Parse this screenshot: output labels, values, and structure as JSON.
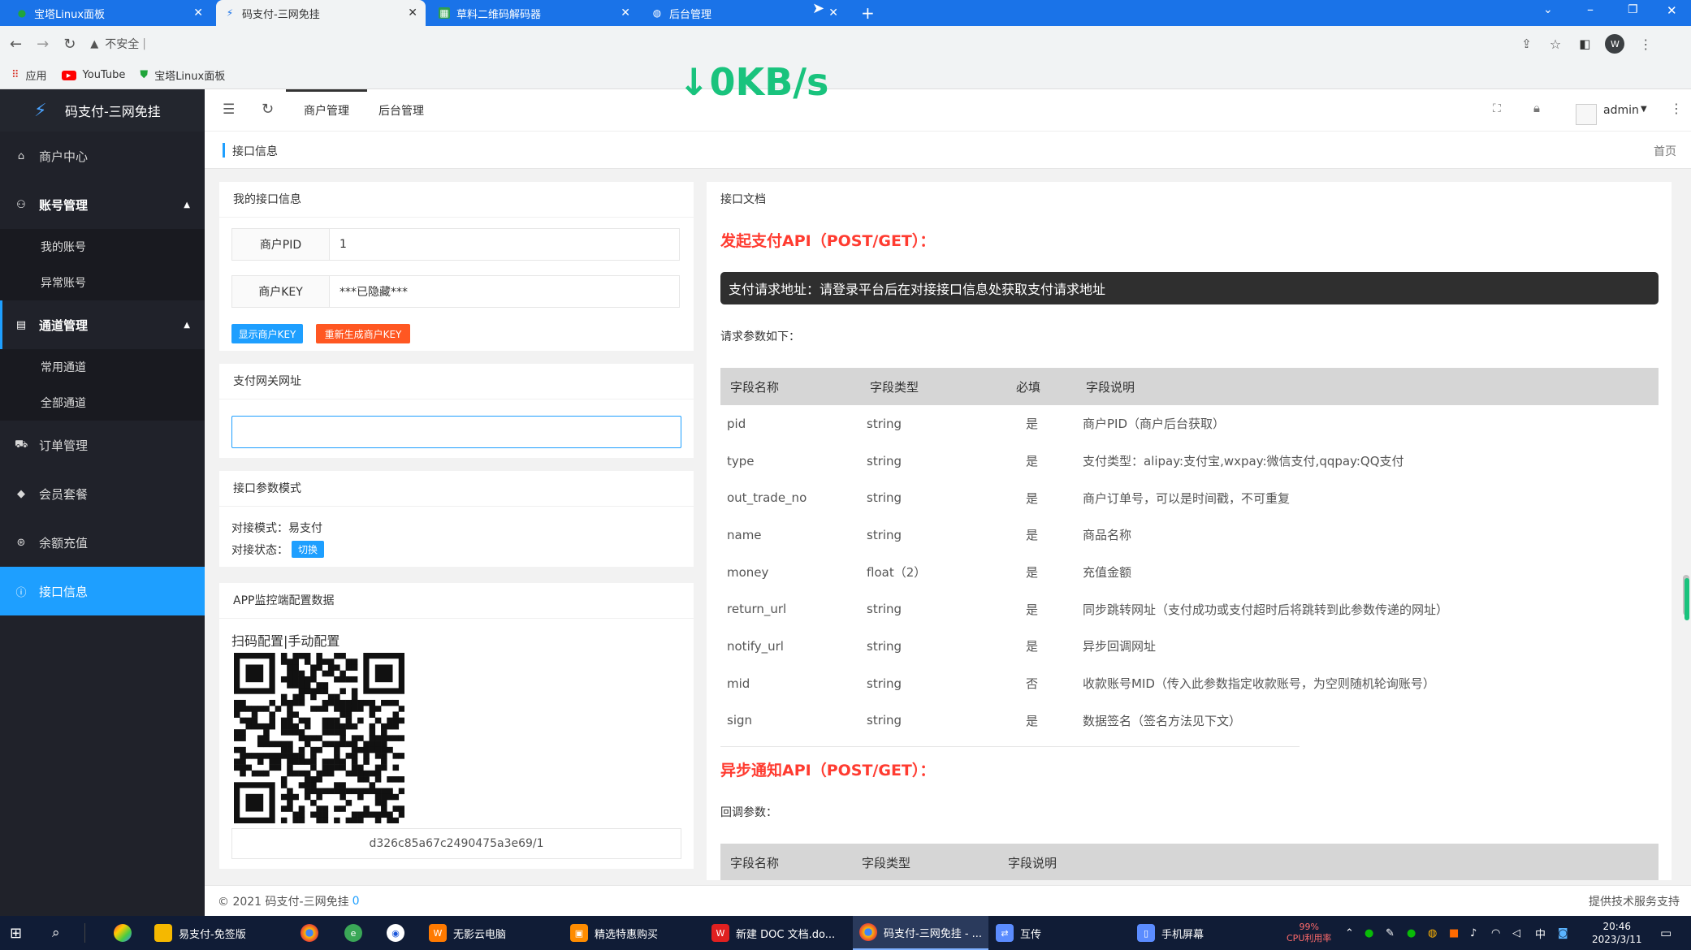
{
  "browser": {
    "tabs": [
      {
        "label": "宝塔Linux面板"
      },
      {
        "label": "码支付-三网免挂"
      },
      {
        "label": "草料二维码解码器"
      },
      {
        "label": "后台管理"
      }
    ],
    "security_label": "不安全",
    "bookmarks": [
      {
        "label": "应用"
      },
      {
        "label": "YouTube"
      },
      {
        "label": "宝塔Linux面板"
      }
    ],
    "profile_initial": "W"
  },
  "overlay": {
    "speed": "↓0KB/s"
  },
  "sidebar": {
    "logo": "码支付-三网免挂",
    "items": [
      {
        "label": "商户中心"
      },
      {
        "label": "账号管理"
      },
      {
        "label": "我的账号"
      },
      {
        "label": "异常账号"
      },
      {
        "label": "通道管理"
      },
      {
        "label": "常用通道"
      },
      {
        "label": "全部通道"
      },
      {
        "label": "订单管理"
      },
      {
        "label": "会员套餐"
      },
      {
        "label": "余额充值"
      },
      {
        "label": "接口信息"
      }
    ]
  },
  "topnav": {
    "menu1": "商户管理",
    "menu2": "后台管理",
    "user": "admin"
  },
  "breadcrumb": {
    "current": "接口信息",
    "home": "首页"
  },
  "api_info": {
    "title": "我的接口信息",
    "pid_label": "商户PID",
    "pid_value": "1",
    "key_label": "商户KEY",
    "key_value": "***已隐藏***",
    "show_key_btn": "显示商户KEY",
    "regen_key_btn": "重新生成商户KEY",
    "btn_blue": "#1e9fff",
    "btn_orange": "#ff5722"
  },
  "gateway": {
    "title": "支付网关网址",
    "value": ""
  },
  "param_mode": {
    "title": "接口参数模式",
    "mode_label": "对接模式：",
    "mode_value": "易支付",
    "status_label": "对接状态：",
    "switch_btn": "切换"
  },
  "app_config": {
    "title": "APP监控端配置数据",
    "subtitle": "扫码配置|手动配置",
    "token": "d326c85a67c2490475a3e69/1"
  },
  "docs": {
    "title": "接口文档",
    "api1_title": "发起支付API（POST/GET）：",
    "api_notice": "支付请求地址：请登录平台后在对接接口信息处获取支付请求地址",
    "req_params_label": "请求参数如下：",
    "headers": [
      "字段名称",
      "字段类型",
      "必填",
      "字段说明"
    ],
    "rows": [
      [
        "pid",
        "string",
        "是",
        "商户PID（商户后台获取）"
      ],
      [
        "type",
        "string",
        "是",
        "支付类型：alipay:支付宝,wxpay:微信支付,qqpay:QQ支付"
      ],
      [
        "out_trade_no",
        "string",
        "是",
        "商户订单号，可以是时间戳，不可重复"
      ],
      [
        "name",
        "string",
        "是",
        "商品名称"
      ],
      [
        "money",
        "float（2）",
        "是",
        "充值金额"
      ],
      [
        "return_url",
        "string",
        "是",
        "同步跳转网址（支付成功或支付超时后将跳转到此参数传递的网址）"
      ],
      [
        "notify_url",
        "string",
        "是",
        "异步回调网址"
      ],
      [
        "mid",
        "string",
        "否",
        "收款账号MID（传入此参数指定收款账号，为空则随机轮询账号）"
      ],
      [
        "sign",
        "string",
        "是",
        "数据签名（签名方法见下文）"
      ]
    ],
    "api2_title": "异步通知API（POST/GET）：",
    "callback_label": "回调参数：",
    "headers2": [
      "字段名称",
      "字段类型",
      "字段说明"
    ],
    "accent": "#ff3b30"
  },
  "footer": {
    "copyright": "© 2021 码支付-三网免挂",
    "copyright_link": "0",
    "right": "提供技术服务支持"
  },
  "taskbar": {
    "items": [
      {
        "label": "易支付-免签版"
      },
      {
        "label": "无影云电脑"
      },
      {
        "label": "精选特惠购买"
      },
      {
        "label": "新建 DOC 文档.do..."
      },
      {
        "label": "码支付-三网免挂 - ..."
      },
      {
        "label": "互传"
      },
      {
        "label": "手机屏幕"
      }
    ],
    "cpu_percent": "99%",
    "cpu_label": "CPU利用率",
    "ime": "中",
    "time": "20:46",
    "date": "2023/3/11"
  }
}
